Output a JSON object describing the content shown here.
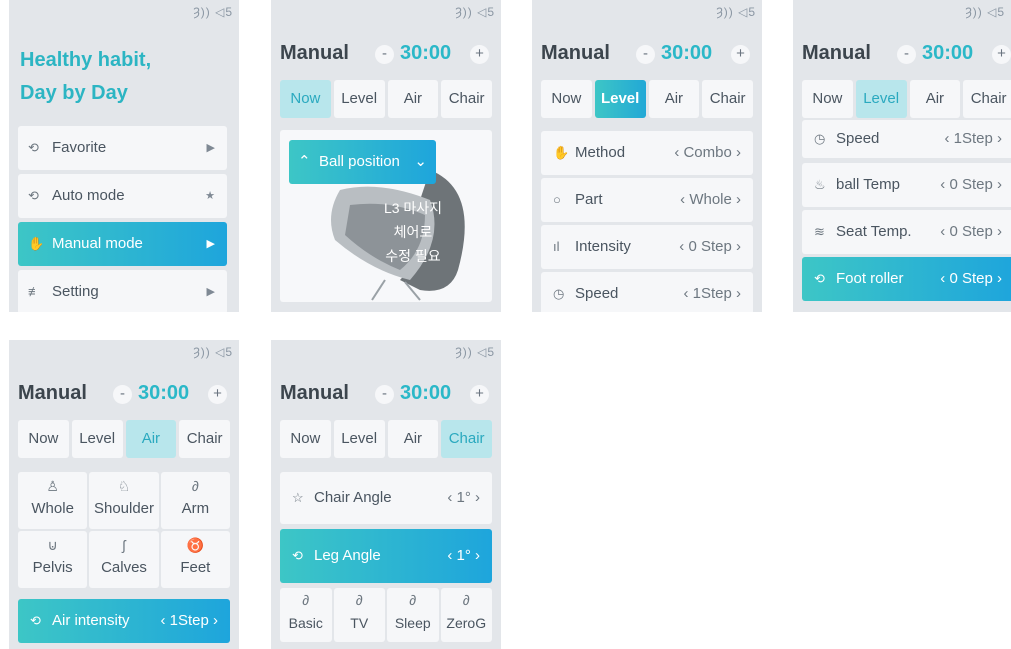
{
  "status": {
    "sound_icon": "speaker-icon",
    "text": "Ȝ)) ◁5"
  },
  "screen1": {
    "headline_line1": "Healthy habit,",
    "headline_line2": "Day by Day",
    "menu": [
      {
        "label": "Favorite",
        "icon": "favorite-icon",
        "trail": "▶"
      },
      {
        "label": "Auto mode",
        "icon": "auto-icon",
        "trail": "★"
      },
      {
        "label": "Manual mode",
        "icon": "hand-icon",
        "trail": "▶"
      },
      {
        "label": "Setting",
        "icon": "sliders-icon",
        "trail": "▶"
      }
    ]
  },
  "common": {
    "title": "Manual",
    "timer": "30:00",
    "minus": "-",
    "plus": "+",
    "tabs": [
      "Now",
      "Level",
      "Air",
      "Chair"
    ]
  },
  "screen2": {
    "ball_position": "Ball position",
    "note_lines": [
      "L3 마사지",
      "체어로",
      "수정 필요"
    ]
  },
  "screen3": {
    "rows": [
      {
        "label": "Method",
        "value": "‹ Combo ›"
      },
      {
        "label": "Part",
        "value": "‹ Whole ›"
      },
      {
        "label": "Intensity",
        "value": "‹ 0 Step ›"
      },
      {
        "label": "Speed",
        "value": "‹ 1Step ›"
      }
    ]
  },
  "screen4": {
    "rows": [
      {
        "label": "Speed",
        "value": "‹ 1Step ›"
      },
      {
        "label": "ball Temp",
        "value": "‹ 0 Step ›"
      },
      {
        "label": "Seat Temp.",
        "value": "‹ 0 Step ›"
      },
      {
        "label": "Foot roller",
        "value": "‹ 0 Step ›"
      }
    ]
  },
  "screen5": {
    "cells": [
      {
        "label": "Whole",
        "icon": "body-icon"
      },
      {
        "label": "Shoulder",
        "icon": "shoulder-icon"
      },
      {
        "label": "Arm",
        "icon": "arm-icon"
      },
      {
        "label": "Pelvis",
        "icon": "pelvis-icon"
      },
      {
        "label": "Calves",
        "icon": "calves-icon"
      },
      {
        "label": "Feet",
        "icon": "feet-icon"
      }
    ],
    "intensity_label": "Air intensity",
    "intensity_value": "‹ 1Step ›"
  },
  "screen6": {
    "chair_angle_label": "Chair Angle",
    "chair_angle_value": "‹   1°   ›",
    "leg_angle_label": "Leg Angle",
    "leg_angle_value": "‹   1°   ›",
    "presets": [
      "Basic",
      "TV",
      "Sleep",
      "ZeroG"
    ]
  }
}
